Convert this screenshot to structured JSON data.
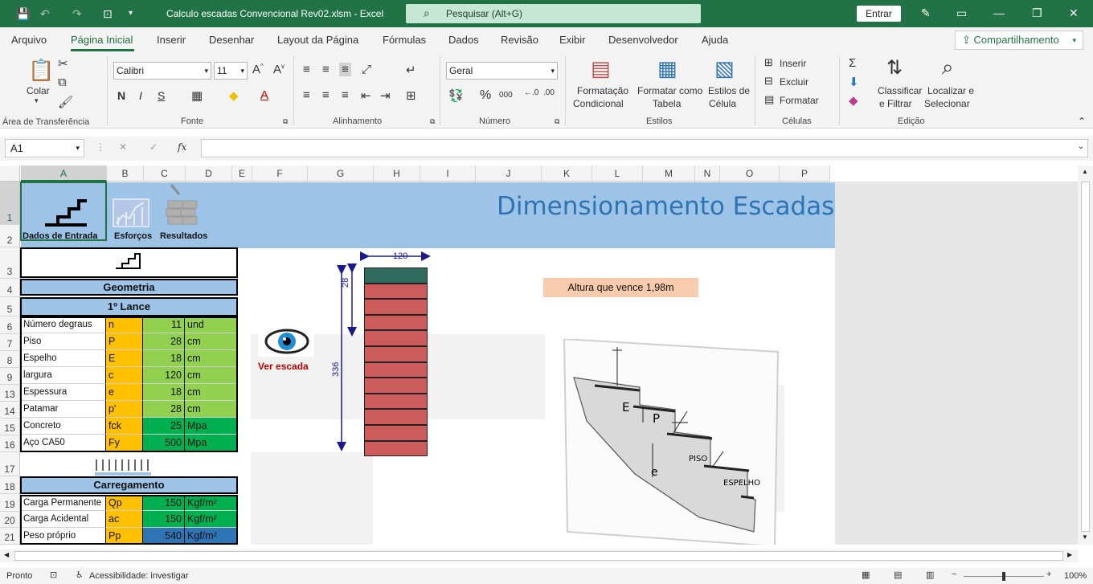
{
  "titlebar": {
    "filename": "Calculo escadas Convencional Rev02.xlsm  -  Excel",
    "search_placeholder": "Pesquisar (Alt+G)",
    "signin": "Entrar"
  },
  "menu": {
    "tabs": [
      "Arquivo",
      "Página Inicial",
      "Inserir",
      "Desenhar",
      "Layout da Página",
      "Fórmulas",
      "Dados",
      "Revisão",
      "Exibir",
      "Desenvolvedor",
      "Ajuda"
    ],
    "share": "Compartilhamento"
  },
  "ribbon": {
    "clipboard": {
      "paste": "Colar",
      "label": "Área de Transferência"
    },
    "font": {
      "name": "Calibri",
      "size": "11",
      "label": "Fonte",
      "bold": "N",
      "italic": "I",
      "underline": "S"
    },
    "alignment": {
      "label": "Alinhamento"
    },
    "number": {
      "format": "Geral",
      "label": "Número"
    },
    "styles": {
      "cond1": "Formatação",
      "cond2": "Condicional",
      "table1": "Formatar como",
      "table2": "Tabela",
      "cell1": "Estilos de",
      "cell2": "Célula",
      "label": "Estilos"
    },
    "cells": {
      "insert": "Inserir",
      "delete": "Excluir",
      "format": "Formatar",
      "label": "Células"
    },
    "editing": {
      "sort1": "Classificar",
      "sort2": "e Filtrar",
      "find1": "Localizar e",
      "find2": "Selecionar",
      "label": "Edição"
    }
  },
  "formula_bar": {
    "namebox": "A1",
    "fx": "fx",
    "formula": ""
  },
  "columns": [
    "A",
    "B",
    "C",
    "D",
    "E",
    "F",
    "G",
    "H",
    "I",
    "J",
    "K",
    "L",
    "M",
    "N",
    "O",
    "P"
  ],
  "rows": [
    "1",
    "2",
    "3",
    "4",
    "5",
    "6",
    "7",
    "8",
    "9",
    "13",
    "14",
    "15",
    "16",
    "17",
    "18",
    "19",
    "20",
    "21"
  ],
  "sheet": {
    "banner_title": "Dimensionamento Escadas",
    "nav": [
      "Dados de Entrada",
      "Esforços",
      "Resultados"
    ],
    "geometria": "Geometria",
    "lance": "1º Lance",
    "params": [
      {
        "label": "Número degraus",
        "sym": "n",
        "val": "11",
        "unit": "und"
      },
      {
        "label": "Piso",
        "sym": "P",
        "val": "28",
        "unit": "cm"
      },
      {
        "label": "Espelho",
        "sym": "E",
        "val": "18",
        "unit": "cm"
      },
      {
        "label": "largura",
        "sym": "c",
        "val": "120",
        "unit": "cm"
      },
      {
        "label": "Espessura",
        "sym": "e",
        "val": "18",
        "unit": "cm"
      },
      {
        "label": "Patamar",
        "sym": "p'",
        "val": "28",
        "unit": "cm"
      },
      {
        "label": "Concreto",
        "sym": "fck",
        "val": "25",
        "unit": "Mpa"
      },
      {
        "label": "Aço CA50",
        "sym": "Fy",
        "val": "500",
        "unit": "Mpa"
      }
    ],
    "carregamento": "Carregamento",
    "loads": [
      {
        "label": "Carga Permanente",
        "sym": "Qp",
        "val": "150",
        "unit": "Kgf/m²"
      },
      {
        "label": "Carga Acidental",
        "sym": "ac",
        "val": "150",
        "unit": "Kgf/m²"
      },
      {
        "label": "Peso próprio",
        "sym": "Pp",
        "val": "540",
        "unit": "Kgf/m²"
      }
    ],
    "ver_escada": "Ver escada",
    "dim_width": "120",
    "dim_step": "28",
    "dim_height": "336",
    "altura": "Altura que vence 1,98m",
    "fig_labels": {
      "e_upper": "E",
      "p": "P",
      "e_lower": "e",
      "piso": "PISO",
      "espelho": "ESPELHO"
    }
  },
  "status": {
    "ready": "Pronto",
    "accessibility": "Acessibilidade: investigar",
    "zoom": "100%"
  },
  "colors": {
    "excel_green": "#217346",
    "banner": "#9dc3e6",
    "title_blue": "#2e74b5",
    "param_blue": "#9dc3e6",
    "sym_orange": "#ffc000",
    "val_green": "#92d050",
    "dark_green": "#00b050",
    "step_red": "#cd5c5c",
    "step_top": "#2f6b5e",
    "altura_bg": "#f8cbad",
    "pp_blue": "#2e75b6"
  }
}
